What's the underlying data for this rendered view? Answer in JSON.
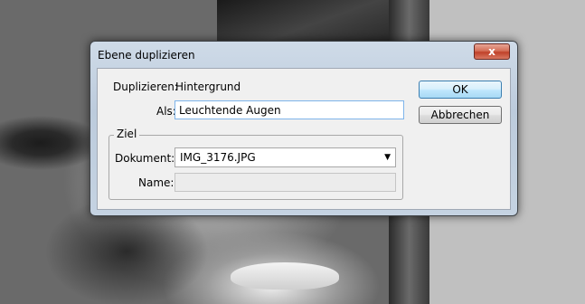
{
  "dialog": {
    "title": "Ebene duplizieren",
    "close_label": "x",
    "duplicate_label": "Duplizieren:",
    "duplicate_value": "Hintergrund",
    "as_label": "Als:",
    "as_value": "Leuchtende Augen",
    "target_group": "Ziel",
    "document_label": "Dokument:",
    "document_value": "IMG_3176.JPG",
    "name_label": "Name:",
    "name_value": "",
    "ok_label": "OK",
    "cancel_label": "Abbrechen"
  },
  "colors": {
    "dialog_frame": "#c5d3e2",
    "client_bg": "#f0f0f0",
    "ok_accent": "#3c7fb1",
    "close_red": "#c0412a",
    "canvas_gray": "#c0c0c0"
  }
}
